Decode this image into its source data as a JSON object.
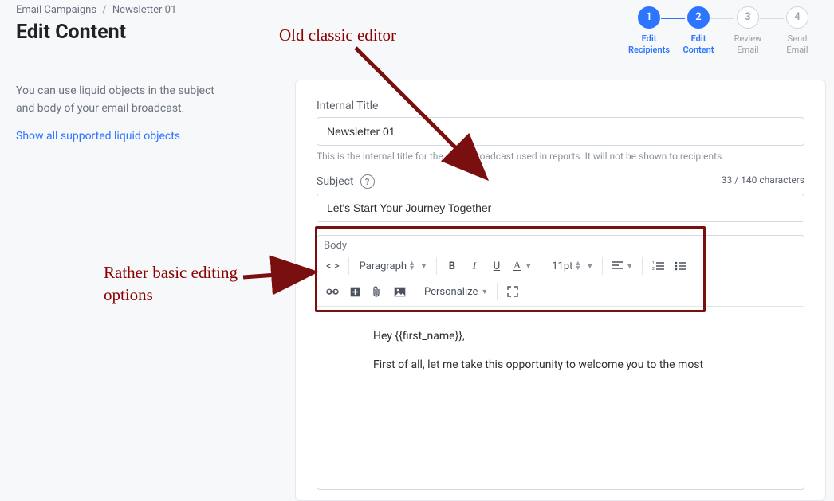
{
  "breadcrumb": {
    "root": "Email Campaigns",
    "leaf": "Newsletter 01"
  },
  "page_title": "Edit Content",
  "help_text": "You can use liquid objects in the subject and body of your email broadcast.",
  "help_link": "Show all supported liquid objects",
  "steps": [
    {
      "num": "1",
      "line1": "Edit",
      "line2": "Recipients"
    },
    {
      "num": "2",
      "line1": "Edit",
      "line2": "Content"
    },
    {
      "num": "3",
      "line1": "Review",
      "line2": "Email"
    },
    {
      "num": "4",
      "line1": "Send",
      "line2": "Email"
    }
  ],
  "form": {
    "title_label": "Internal Title",
    "title_value": "Newsletter 01",
    "title_hint": "This is the internal title for the email broadcast used in reports. It will not be shown to recipients.",
    "subject_label": "Subject",
    "subject_value": "Let's Start Your Journey Together",
    "char_count": "33 / 140 characters",
    "body_label": "Body",
    "toolbar": {
      "block": "Paragraph",
      "fontsize": "11pt",
      "personalize": "Personalize"
    },
    "body_value_line1": "Hey {{first_name}},",
    "body_value_line2": "First of all, let me take this opportunity to welcome you to the most"
  },
  "annotations": {
    "top": "Old classic editor",
    "left": "Rather basic editing options"
  }
}
